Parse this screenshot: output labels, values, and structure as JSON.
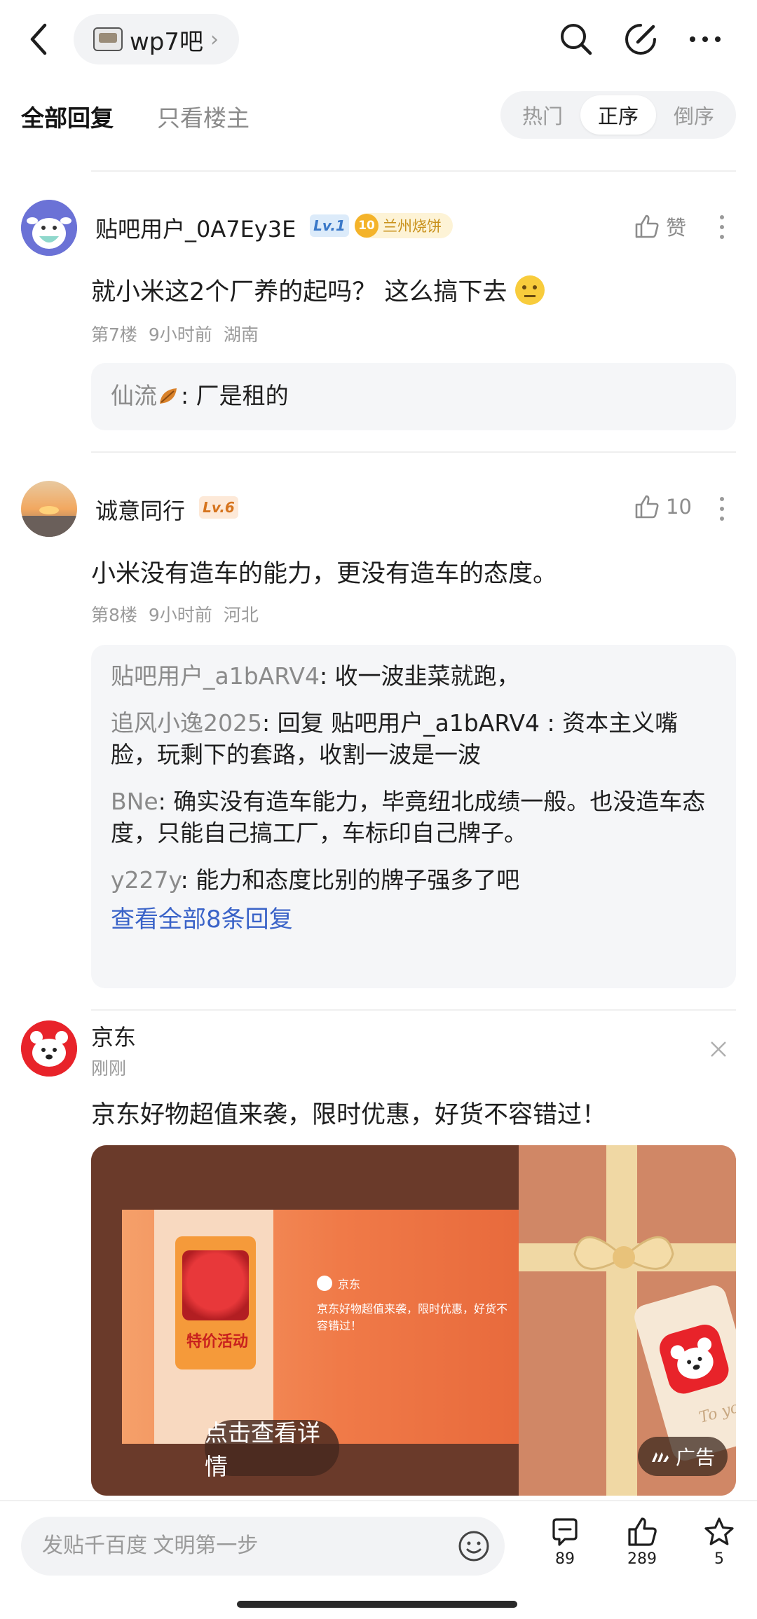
{
  "header": {
    "forum_name": "wp7吧",
    "icons": [
      "back-icon",
      "search-icon",
      "edit-icon",
      "more-icon"
    ]
  },
  "tabs": {
    "all_replies": "全部回复",
    "owner_only": "只看楼主",
    "sort": [
      "热门",
      "正序",
      "倒序"
    ],
    "active_sort": "正序"
  },
  "posts": [
    {
      "username": "贴吧用户_0A7Ey3E",
      "level": "Lv.1",
      "badge_num": "10",
      "badge_text": "兰州烧饼",
      "likes": "赞",
      "text": "就小米这2个厂养的起吗？ 这么搞下去",
      "floor": "第7楼",
      "time": "9小时前",
      "location": "湖南",
      "replies": [
        {
          "user": "仙流",
          "text": ": 厂是租的"
        }
      ]
    },
    {
      "username": "诚意同行",
      "level": "Lv.6",
      "likes": "10",
      "text": "小米没有造车的能力，更没有造车的态度。",
      "floor": "第8楼",
      "time": "9小时前",
      "location": "河北",
      "replies": [
        {
          "user": "贴吧用户_a1bARV4",
          "text": ": 收一波韭菜就跑，"
        },
        {
          "user": "追风小逸2025",
          "text": ": 回复 贴吧用户_a1bARV4 : 资本主义嘴脸，玩剩下的套路，收割一波是一波"
        },
        {
          "user": "BNe",
          "text": ": 确实没有造车能力，毕竟纽北成绩一般。也没造车态度，只能自己搞工厂，车标印自己牌子。"
        },
        {
          "user": "y227y",
          "text": ": 能力和态度比别的牌子强多了吧"
        }
      ],
      "view_all": "查看全部8条回复"
    }
  ],
  "ad": {
    "advertiser": "京东",
    "time": "刚刚",
    "text": "京东好物超值来袭，限时优惠，好货不容错过！",
    "card_brand": "京东",
    "card_text": "京东好物超值来袭，限时优惠，好货不容错过！",
    "promo_label": "特价活动",
    "cta": "点击查看详情",
    "tag": "广告",
    "gift_tag": "To you"
  },
  "bottom": {
    "placeholder": "发贴千百度 文明第一步",
    "comments": "89",
    "likes": "289",
    "favorites": "5"
  },
  "colors": {
    "link": "#3a63c8",
    "lv1_bg": "#dcebfa",
    "lv6_bg": "#fde9d8",
    "ad_bg": "#c96f52"
  }
}
